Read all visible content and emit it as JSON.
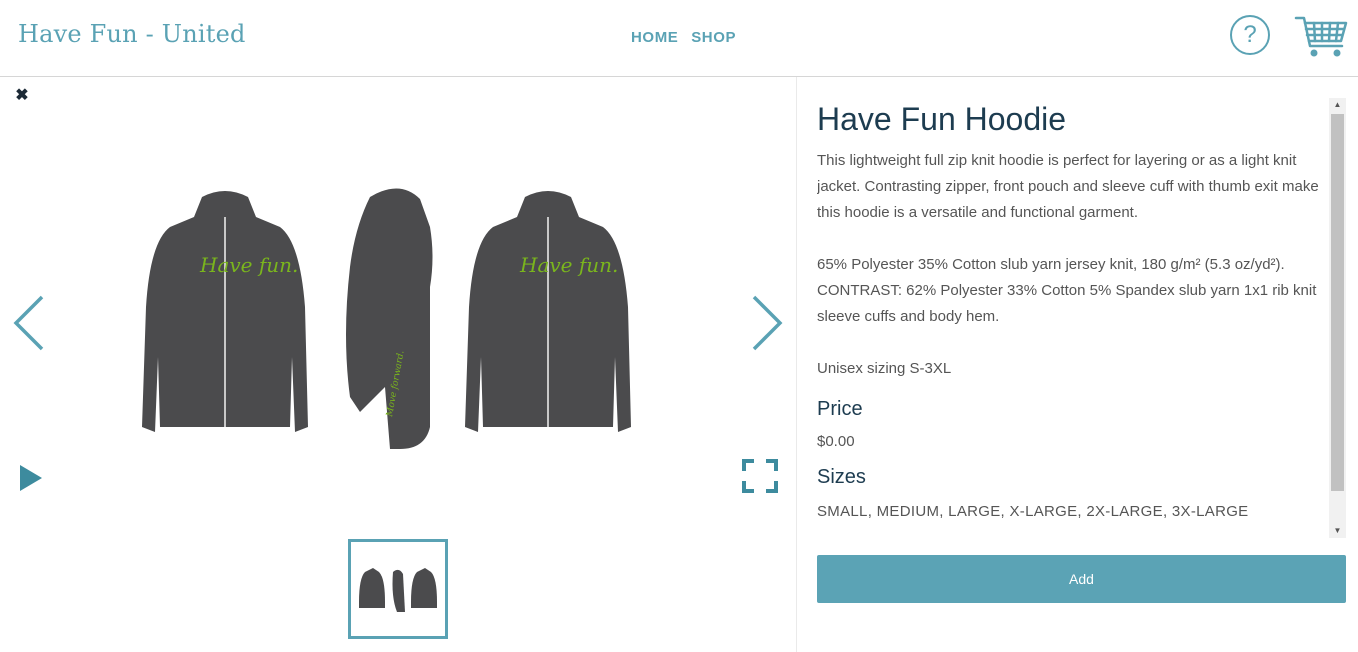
{
  "header": {
    "site_title": "Have Fun - United",
    "nav": [
      {
        "label": "HOME"
      },
      {
        "label": "SHOP"
      }
    ],
    "help_label": "?",
    "cart_icon": "shopping-cart-icon"
  },
  "gallery": {
    "close_label": "✖",
    "main_image_icon": "hoodie-three-views",
    "thumbnail_icon": "hoodie-three-views",
    "prev_icon": "chevron-left-icon",
    "next_icon": "chevron-right-icon",
    "play_icon": "play-icon",
    "fullscreen_icon": "fullscreen-icon",
    "print_text": "Have fun.",
    "sleeve_text": "Move forward."
  },
  "product": {
    "title": "Have Fun Hoodie",
    "description": [
      "This lightweight full zip knit hoodie is perfect for layering or as a light knit jacket. Contrasting zipper, front pouch and sleeve cuff with thumb exit make this hoodie is a versatile and functional garment.",
      "65% Polyester 35% Cotton slub yarn jersey knit, 180 g/m² (5.3 oz/yd²). CONTRAST: 62% Polyester 33% Cotton 5% Spandex slub yarn 1x1 rib knit sleeve cuffs and body hem.",
      "Unisex sizing S-3XL"
    ],
    "price_label": "Price",
    "price_value": "$0.00",
    "sizes_label": "Sizes",
    "sizes_value": "SMALL, MEDIUM, LARGE, X-LARGE, 2X-LARGE, 3X-LARGE"
  },
  "actions": {
    "add_label": "Add"
  },
  "colors": {
    "accent": "#5aa2b4",
    "title": "#1d3c50",
    "hoodie": "#4a4a4a",
    "print_green": "#7ab51d"
  }
}
